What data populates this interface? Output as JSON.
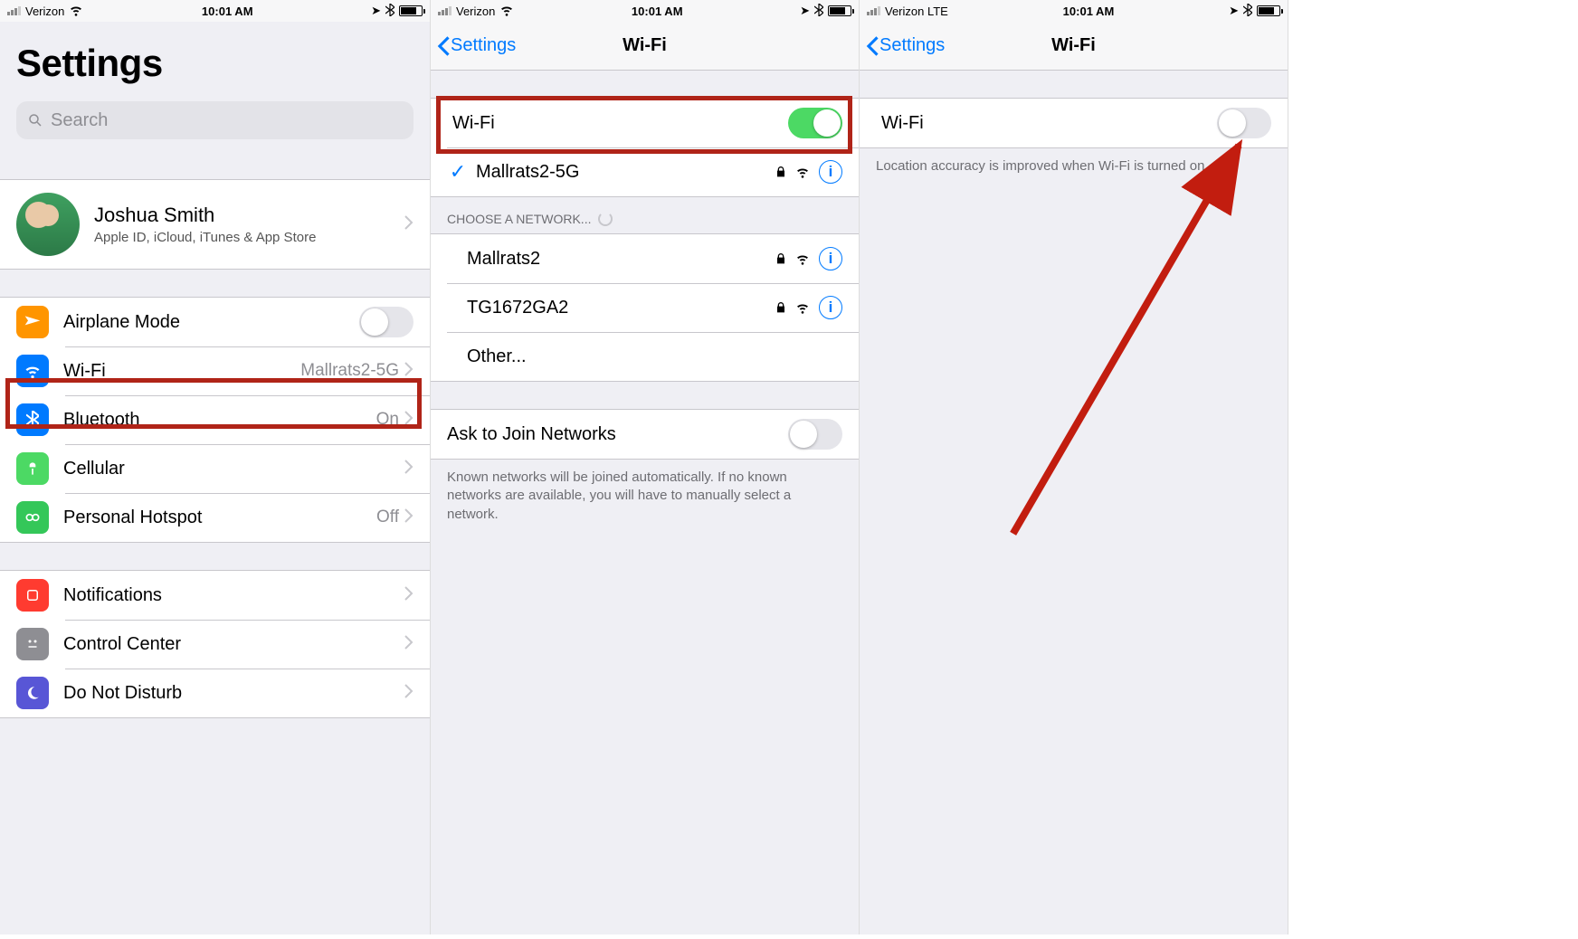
{
  "status": {
    "carrier_wifi": "Verizon",
    "carrier_lte": "Verizon  LTE",
    "time": "10:01 AM"
  },
  "screen1": {
    "title": "Settings",
    "search_placeholder": "Search",
    "profile": {
      "name": "Joshua Smith",
      "sub": "Apple ID, iCloud, iTunes & App Store"
    },
    "rows": {
      "airplane": "Airplane Mode",
      "wifi": "Wi-Fi",
      "wifi_detail": "Mallrats2-5G",
      "bluetooth": "Bluetooth",
      "bluetooth_detail": "On",
      "cellular": "Cellular",
      "hotspot": "Personal Hotspot",
      "hotspot_detail": "Off",
      "notifications": "Notifications",
      "control_center": "Control Center",
      "dnd": "Do Not Disturb"
    }
  },
  "screen2": {
    "back": "Settings",
    "title": "Wi-Fi",
    "toggle_label": "Wi-Fi",
    "connected": "Mallrats2-5G",
    "choose_header": "CHOOSE A NETWORK...",
    "networks": [
      "Mallrats2",
      "TG1672GA2"
    ],
    "other": "Other...",
    "ask_label": "Ask to Join Networks",
    "ask_footnote": "Known networks will be joined automatically. If no known networks are available, you will have to manually select a network."
  },
  "screen3": {
    "back": "Settings",
    "title": "Wi-Fi",
    "toggle_label": "Wi-Fi",
    "footnote": "Location accuracy is improved when Wi-Fi is turned on."
  }
}
